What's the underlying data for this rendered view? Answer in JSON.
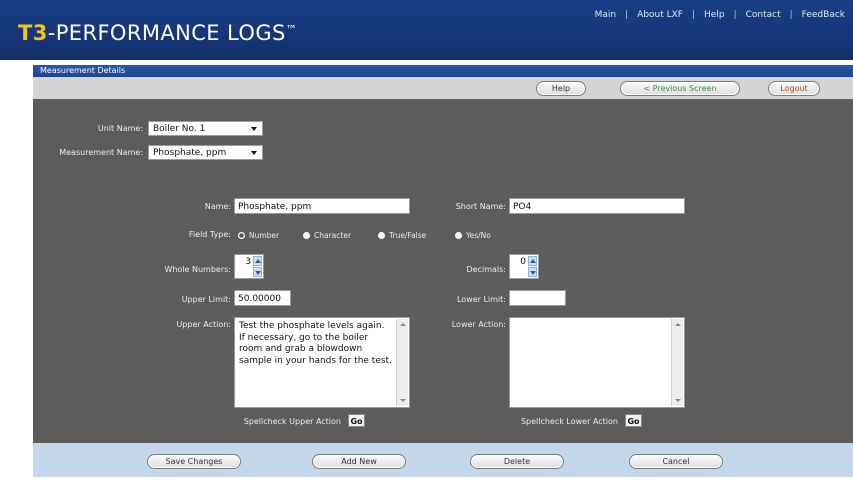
{
  "header": {
    "logo_prefix": "T3",
    "logo_rest": "-PERFORMANCE LOGS",
    "logo_tm": "™",
    "nav": [
      "Main",
      "About LXF",
      "Help",
      "Contact",
      "FeedBack"
    ]
  },
  "panel": {
    "title": "Measurement Details",
    "toolbar": {
      "help": "Help",
      "previous": "< Previous Screen",
      "logout": "Logout"
    }
  },
  "selectors": {
    "unit_label": "Unit Name:",
    "unit_value": "Boiler No. 1",
    "measurement_label": "Measurement Name:",
    "measurement_value": "Phosphate, ppm"
  },
  "form": {
    "name_label": "Name:",
    "name_value": "Phosphate, ppm",
    "short_label": "Short Name:",
    "short_value": "PO4",
    "field_type_label": "Field Type:",
    "field_types": [
      "Number",
      "Character",
      "True/False",
      "Yes/No"
    ],
    "field_type_selected": "Number",
    "whole_label": "Whole Numbers:",
    "whole_value": "3",
    "decimals_label": "Decimals:",
    "decimals_value": "0",
    "upper_limit_label": "Upper Limit:",
    "upper_limit_value": "50.00000",
    "lower_limit_label": "Lower Limit:",
    "lower_limit_value": "",
    "upper_action_label": "Upper Action:",
    "upper_action_value": "Test the phosphate levels again. If necessary, go to the boiler room and grab a blowdown sample in your hands for the test.",
    "lower_action_label": "Lower Action:",
    "lower_action_value": "",
    "spell_upper_label": "Spellcheck Upper Action",
    "spell_lower_label": "Spellcheck Lower Action",
    "go_label": "Go"
  },
  "actions": {
    "save": "Save Changes",
    "add": "Add New",
    "delete": "Delete",
    "cancel": "Cancel"
  },
  "colors": {
    "header_blue": "#16367a",
    "logo_accent": "#f1c41c",
    "panel_gray": "#5c5c5c",
    "toolbar_gray": "#d4d4d4",
    "bottom_bar": "#c5d7ea"
  }
}
